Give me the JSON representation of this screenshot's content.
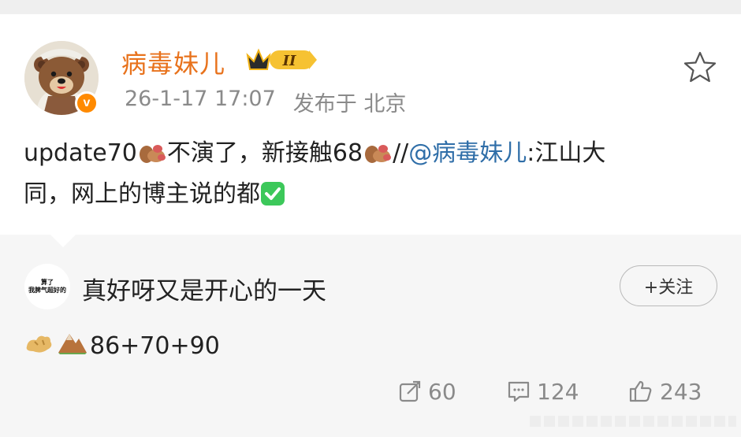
{
  "post": {
    "username": "病毒妹儿",
    "level_badge": "II",
    "verified_badge": "v",
    "date": "26-1-17 17:07",
    "location": "发布于 北京",
    "text_part1": "update70",
    "text_part2": "不演了，新接触68",
    "text_part3": "//",
    "mention": "@病毒妹儿",
    "text_part4": ":江山大",
    "text_line2": "同，网上的博主说的都"
  },
  "comment": {
    "avatar_line1": "算了",
    "avatar_line2": "我脾气超好的",
    "text": "真好呀又是开心的一天",
    "follow_label": "+关注",
    "score_text": "86+70+90"
  },
  "actions": {
    "repost_count": "60",
    "comment_count": "124",
    "like_count": "243"
  },
  "colors": {
    "username": "#e8721c",
    "mention": "#2f6ea8",
    "verified": "#ff8a00",
    "check": "#3cc85a"
  }
}
